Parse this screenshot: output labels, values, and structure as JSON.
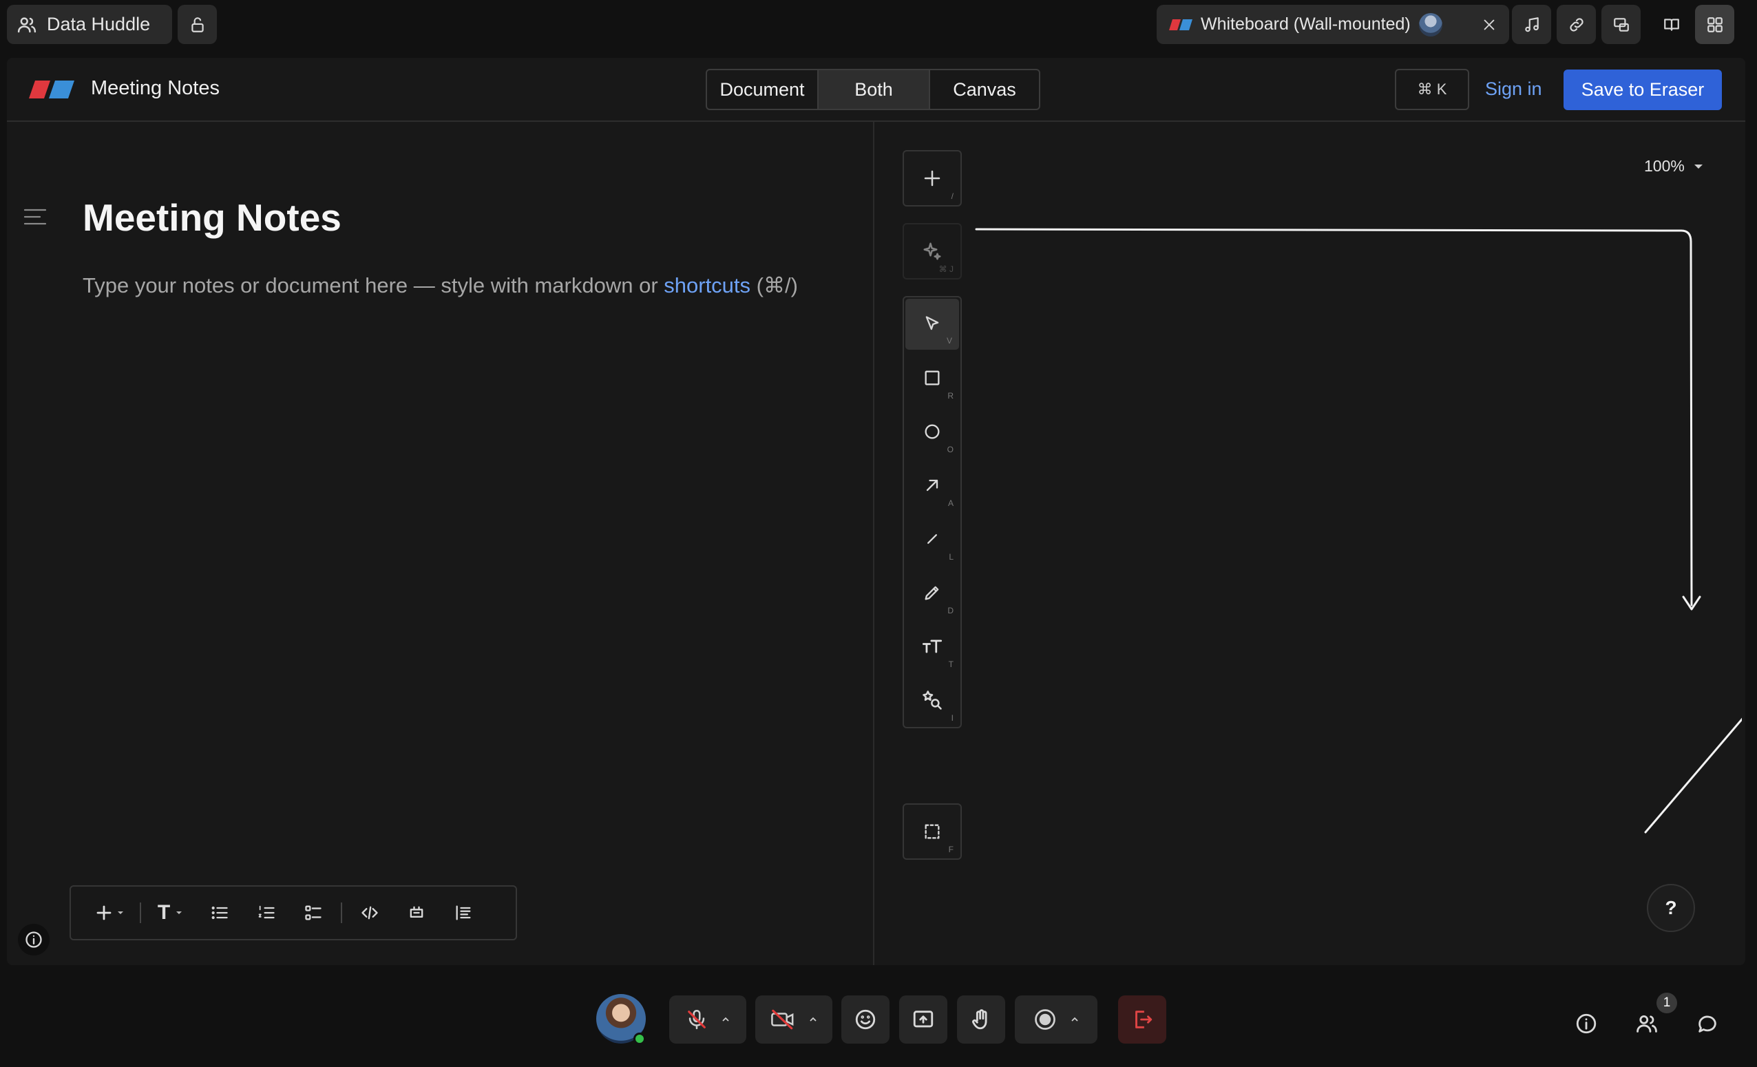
{
  "call": {
    "title": "Data Huddle",
    "whiteboard_label": "Whiteboard (Wall-mounted)",
    "participant_count": "1"
  },
  "app": {
    "doc_title": "Meeting Notes",
    "view_modes": [
      "Document",
      "Both",
      "Canvas"
    ],
    "active_view": "Both",
    "shortcut_hint": "⌘ K",
    "sign_in_label": "Sign in",
    "save_label": "Save to Eraser",
    "accent_color": "#2f62d8"
  },
  "document": {
    "heading": "Meeting Notes",
    "placeholder_before": "Type your notes or document here — style with markdown or ",
    "placeholder_link": "shortcuts",
    "placeholder_after": " (⌘/)",
    "format_T": "T"
  },
  "canvas": {
    "zoom": "100%",
    "help_label": "?",
    "tool_keys": {
      "add": "/",
      "ai": "⌘ J",
      "select": "V",
      "rectangle": "R",
      "ellipse": "O",
      "arrow": "A",
      "line": "L",
      "pen": "D",
      "text": "T",
      "image": "I",
      "frame": "F"
    },
    "tools": [
      "add",
      "ai",
      "select",
      "rectangle",
      "ellipse",
      "arrow",
      "line",
      "pen",
      "text",
      "image",
      "frame"
    ],
    "selected_tool": "select"
  }
}
